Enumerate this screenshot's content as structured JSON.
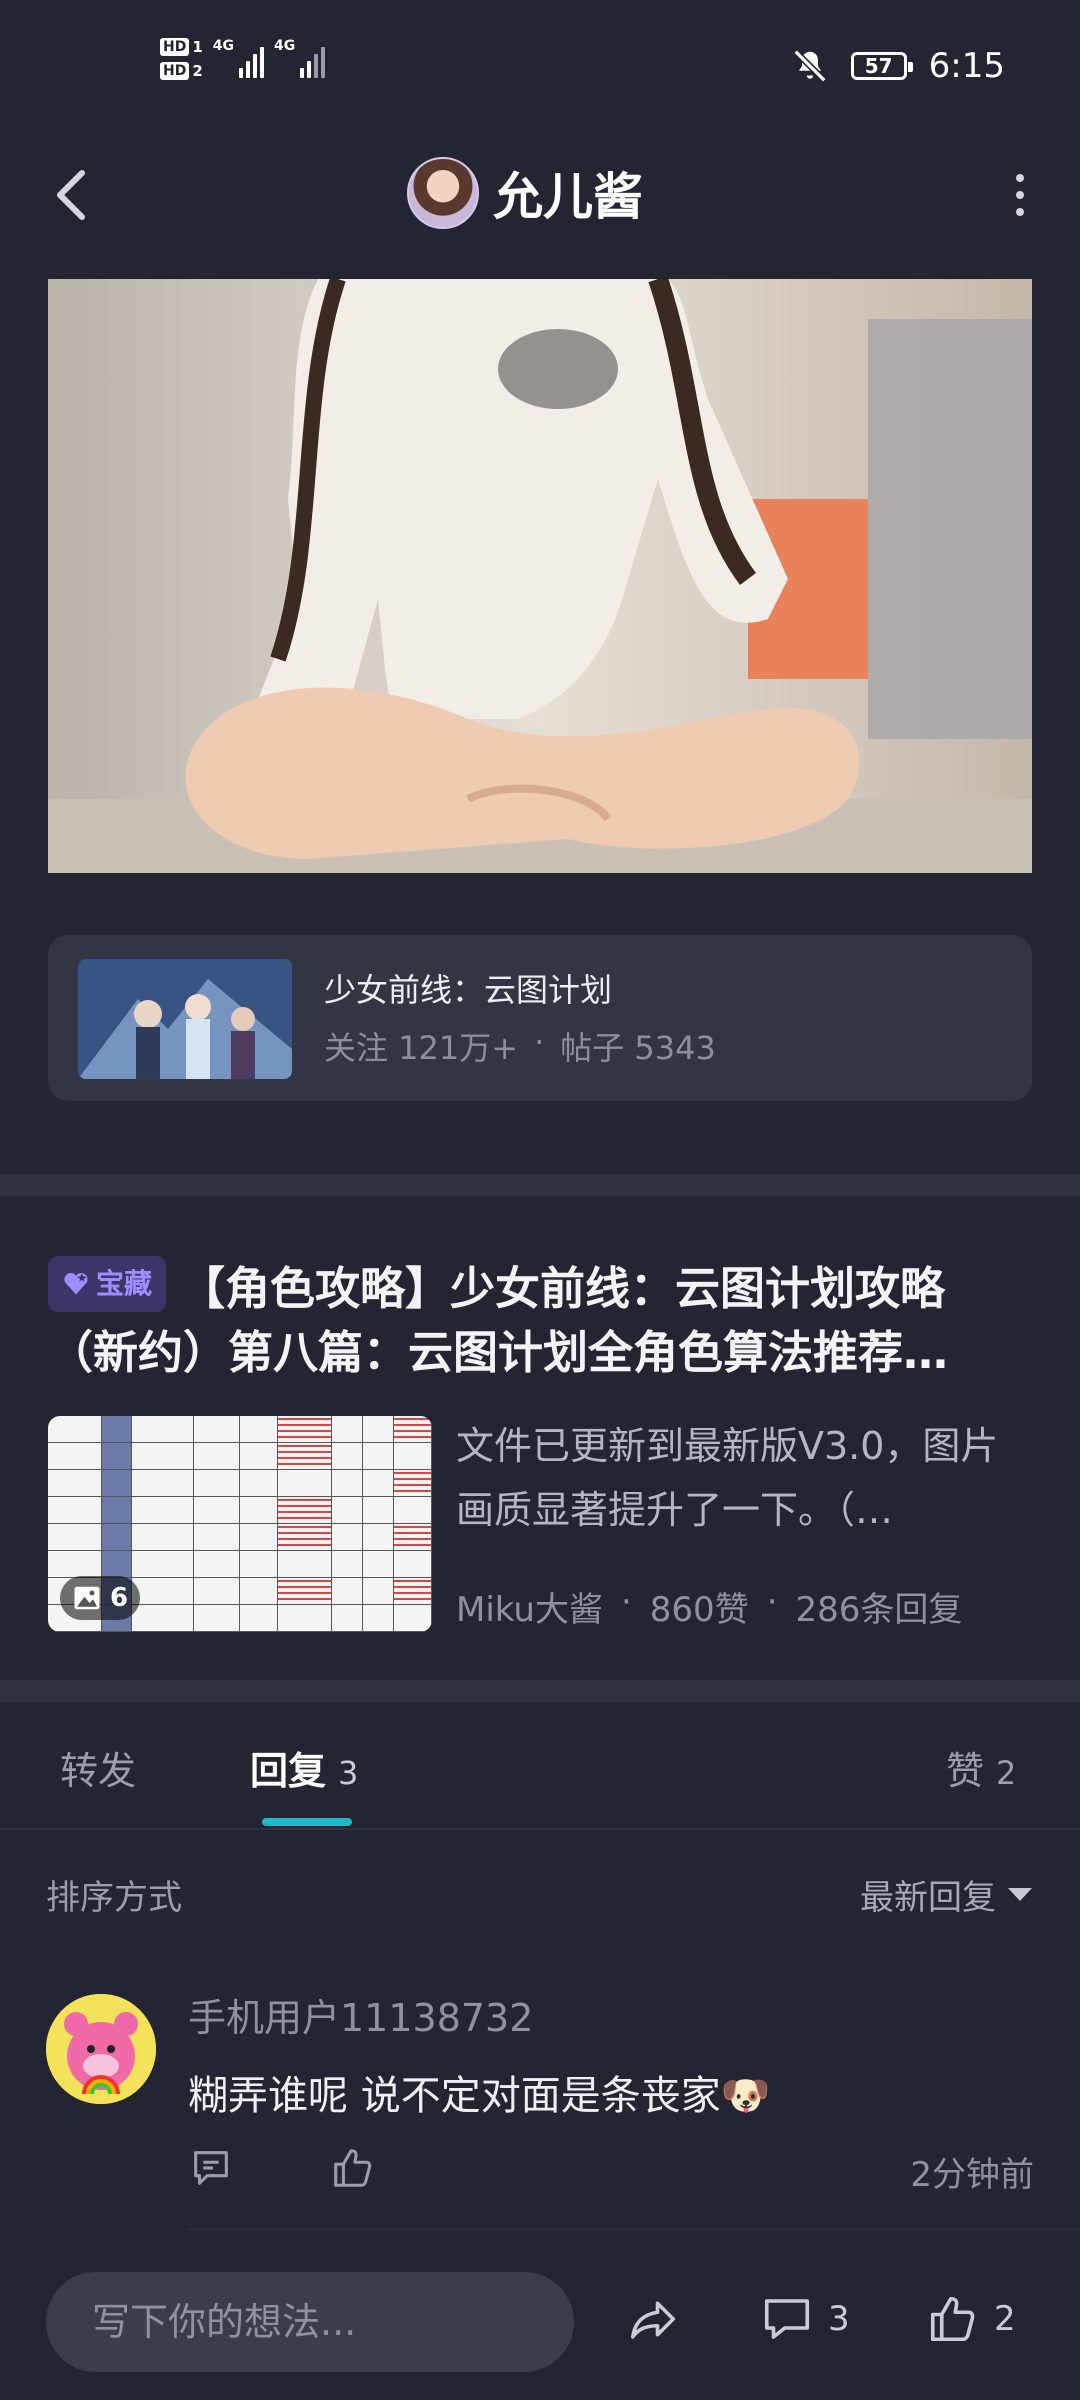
{
  "status_bar": {
    "sim1_label": "HD",
    "sim1_num": "1",
    "sim2_label": "HD",
    "sim2_num": "2",
    "net1": "4G",
    "net2": "4G",
    "battery": "57",
    "time": "6:15"
  },
  "header": {
    "title": "允儿酱"
  },
  "forum": {
    "name": "少女前线：云图计划",
    "followers": "关注 121万+",
    "separator": "·",
    "posts": "帖子 5343"
  },
  "post": {
    "badge": "宝藏",
    "title": "【角色攻略】少女前线：云图计划攻略（新约）第八篇：云图计划全角色算法推荐…",
    "excerpt": "文件已更新到最新版V3.0，图片画质显著提升了一下。（…",
    "image_count": "6",
    "author": "Miku大酱",
    "likes": "860赞",
    "replies": "286条回复",
    "separator": "·"
  },
  "tabs": {
    "forward_label": "转发",
    "reply_label": "回复",
    "reply_count": "3",
    "like_label": "赞",
    "like_count": "2",
    "active": "reply"
  },
  "sort": {
    "label": "排序方式",
    "selected": "最新回复"
  },
  "comments": [
    {
      "user": "手机用户11138732",
      "text": "糊弄谁呢 说不定对面是条丧家🐶",
      "time": "2分钟前"
    }
  ],
  "bottom_bar": {
    "placeholder": "写下你的想法...",
    "comment_count": "3",
    "like_count": "2"
  },
  "colors": {
    "background": "#232632",
    "card": "#323644",
    "accent_tab": "#1fb8c4",
    "badge_bg": "#3b3568",
    "badge_fg": "#a08cff"
  }
}
